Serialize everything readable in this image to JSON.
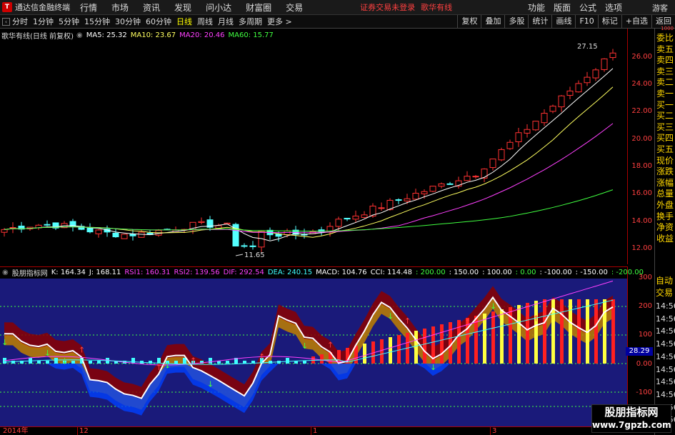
{
  "app": {
    "title": "通达信金融终端",
    "menu": [
      "行情",
      "市场",
      "资讯",
      "发现",
      "问小达",
      "财富圈",
      "交易"
    ],
    "notice": "证券交易未登录",
    "stock_tab": "歌华有线",
    "menu_right": [
      "功能",
      "版面",
      "公式",
      "选项"
    ],
    "user": "游客"
  },
  "toolbar": {
    "periods": [
      "分时",
      "1分钟",
      "5分钟",
      "15分钟",
      "30分钟",
      "60分钟",
      "日线",
      "周线",
      "月线",
      "多周期",
      "更多 >"
    ],
    "active_period": "日线",
    "right_buttons": [
      "复权",
      "叠加",
      "多股",
      "统计",
      "画线",
      "F10",
      "标记",
      "+自选",
      "返回"
    ]
  },
  "main": {
    "stock_name": "歌华有线(日线 前复权)",
    "ma5": "MA5: 25.32",
    "ma10": "MA10: 23.67",
    "ma20": "MA20: 20.46",
    "ma60": "MA60: 15.77",
    "high_label": "27.15",
    "low_label": "11.65",
    "price_ticks": [
      "26.00",
      "24.00",
      "22.00",
      "20.00",
      "18.00",
      "16.00",
      "14.00",
      "12.00"
    ]
  },
  "indicator": {
    "name": "股朋指标网",
    "k": "K: 164.34",
    "j": "J: 168.11",
    "rsi1": "RSI1: 160.31",
    "rsi2": "RSI2: 139.56",
    "dif": "DIF: 292.54",
    "dea": "DEA: 240.15",
    "macd": "MACD: 104.76",
    "cci": "CCI: 114.48",
    "lv1": ": 200.00",
    "lv2": ": 150.00",
    "lv3": ": 100.00",
    "lv4": ": 0.00",
    "lv5": ": -100.00",
    "lv6": ": -150.00",
    "lv7": ": -200.00",
    "axis_ticks": [
      "300",
      "200",
      "100",
      "0.00",
      "-100"
    ],
    "current_value": "28.29"
  },
  "right_panel": {
    "top_badge": "1000",
    "items": [
      "委比",
      "卖五",
      "卖四",
      "卖三",
      "卖二",
      "卖一",
      "买一",
      "买二",
      "买三",
      "买四",
      "买五",
      "现价",
      "涨跌",
      "涨幅",
      "总量",
      "外盘",
      "换手",
      "净资",
      "收益"
    ],
    "auto": [
      "自动",
      "交易"
    ],
    "times": [
      "14:56",
      "14:56",
      "14:56",
      "14:56",
      "14:56",
      "14:56",
      "14:56",
      "14:56",
      "14:56",
      "14:56"
    ]
  },
  "dates": [
    "2014年",
    "12",
    "1",
    "3"
  ],
  "watermark": {
    "line1": "股朋指标网",
    "line2": "www.7gpzb.com"
  },
  "colors": {
    "up": "#ff3232",
    "down": "#54ffff",
    "ma5": "#ffffff",
    "ma10": "#ffff60",
    "ma20": "#ff40ff",
    "ma60": "#40ff40"
  }
}
